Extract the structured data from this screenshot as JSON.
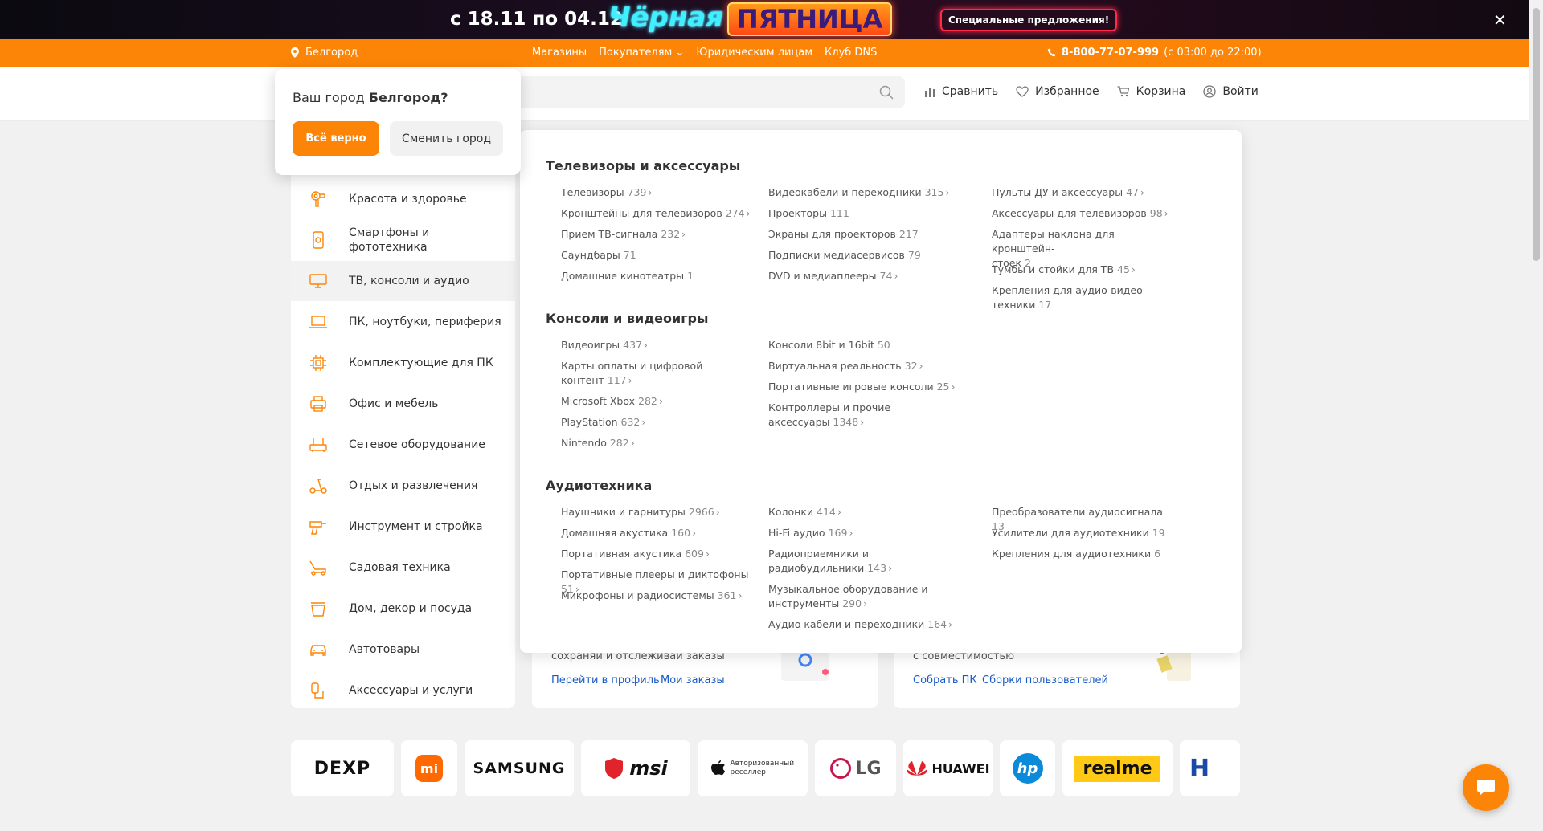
{
  "promo": {
    "dates": "с 18.11 по 04.12",
    "title_part1": "Чёрная",
    "title_part2": "ПЯТНИЦА",
    "special": "Специальные предложения!",
    "close_icon": "close-icon"
  },
  "topbar": {
    "city": "Белгород",
    "nav": [
      "Магазины",
      "Покупателям",
      "Юридическим лицам",
      "Клуб DNS"
    ],
    "phone": "8-800-77-07-999",
    "hours": "(с 03:00 до 22:00)"
  },
  "header": {
    "search_placeholder": "",
    "actions": [
      "Сравнить",
      "Избранное",
      "Корзина",
      "Войти"
    ]
  },
  "city_popup": {
    "question": "Ваш город ",
    "city": "Белгород?",
    "confirm": "Всё верно",
    "change": "Сменить город"
  },
  "sidebar": {
    "items": [
      {
        "label": "Красота и здоровье",
        "icon": "hairdryer-icon"
      },
      {
        "label": "Смартфоны и фототехника",
        "icon": "smartphone-icon"
      },
      {
        "label": "ТВ, консоли и аудио",
        "icon": "tv-icon"
      },
      {
        "label": "ПК, ноутбуки, периферия",
        "icon": "laptop-icon"
      },
      {
        "label": "Комплектующие для ПК",
        "icon": "chip-icon"
      },
      {
        "label": "Офис и мебель",
        "icon": "printer-icon"
      },
      {
        "label": "Сетевое оборудование",
        "icon": "router-icon"
      },
      {
        "label": "Отдых и развлечения",
        "icon": "scooter-icon"
      },
      {
        "label": "Инструмент и стройка",
        "icon": "drill-icon"
      },
      {
        "label": "Садовая техника",
        "icon": "lawnmower-icon"
      },
      {
        "label": "Дом, декор и посуда",
        "icon": "pot-icon"
      },
      {
        "label": "Автотовары",
        "icon": "car-icon"
      },
      {
        "label": "Аксессуары и услуги",
        "icon": "accessories-icon"
      }
    ]
  },
  "mega": {
    "sections": [
      {
        "title": "Телевизоры и аксессуары",
        "col1": [
          {
            "t": "Телевизоры",
            "n": "739",
            "c": true
          },
          {
            "t": "Кронштейны для телевизоров",
            "n": "274",
            "c": true
          },
          {
            "t": "Прием ТВ-сигнала",
            "n": "232",
            "c": true
          },
          {
            "t": "Саундбары",
            "n": "71",
            "c": false
          },
          {
            "t": "Домашние кинотеатры",
            "n": "1",
            "c": false
          }
        ],
        "col2": [
          {
            "t": "Видеокабели и переходники",
            "n": "315",
            "c": true
          },
          {
            "t": "Проекторы",
            "n": "111",
            "c": false
          },
          {
            "t": "Экраны для проекторов",
            "n": "217",
            "c": false
          },
          {
            "t": "Подписки медиасервисов",
            "n": "79",
            "c": false
          },
          {
            "t": "DVD и медиаплееры",
            "n": "74",
            "c": true
          }
        ],
        "col3": [
          {
            "t": "Пульты ДУ и аксессуары",
            "n": "47",
            "c": true
          },
          {
            "t": "Аксессуары для телевизоров",
            "n": "98",
            "c": true
          },
          {
            "t": "Адаптеры наклона для кронштейн-",
            "t2": "стоек",
            "n": "2",
            "c": false
          },
          {
            "t": "Тумбы и стойки для ТВ",
            "n": "45",
            "c": true
          },
          {
            "t": "Крепления для аудио-видео",
            "t2": "техники",
            "n": "17",
            "c": false
          }
        ]
      },
      {
        "title": "Консоли и видеоигры",
        "col1": [
          {
            "t": "Видеоигры",
            "n": "437",
            "c": true
          },
          {
            "t": "Карты оплаты и цифровой",
            "t2": "контент",
            "n": "117",
            "c": true
          },
          {
            "t": "Microsoft Xbox",
            "n": "282",
            "c": true
          },
          {
            "t": "PlayStation",
            "n": "632",
            "c": true
          },
          {
            "t": "Nintendo",
            "n": "282",
            "c": true
          }
        ],
        "col2": [
          {
            "t": "Консоли 8bit и 16bit",
            "n": "50",
            "c": false
          },
          {
            "t": "Виртуальная реальность",
            "n": "32",
            "c": true
          },
          {
            "t": "Портативные игровые консоли",
            "n": "25",
            "c": true
          },
          {
            "t": "Контроллеры и прочие",
            "t2": "аксессуары",
            "n": "1348",
            "c": true
          }
        ],
        "col3": []
      },
      {
        "title": "Аудиотехника",
        "col1": [
          {
            "t": "Наушники и гарнитуры",
            "n": "2966",
            "c": true
          },
          {
            "t": "Домашняя акустика",
            "n": "160",
            "c": true
          },
          {
            "t": "Портативная акустика",
            "n": "609",
            "c": true
          },
          {
            "t": "Портативные плееры и диктофоны",
            "n": "51",
            "c": true
          },
          {
            "t": "Микрофоны и радиосистемы",
            "n": "361",
            "c": true
          }
        ],
        "col2": [
          {
            "t": "Колонки",
            "n": "414",
            "c": true
          },
          {
            "t": "Hi-Fi аудио",
            "n": "169",
            "c": true
          },
          {
            "t": "Радиоприемники и",
            "t2": "радиобудильники",
            "n": "143",
            "c": true
          },
          {
            "t": "Музыкальное оборудование и",
            "t2": "инструменты",
            "n": "290",
            "c": true
          },
          {
            "t": "Аудио кабели и переходники",
            "n": "164",
            "c": true
          }
        ],
        "col3": [
          {
            "t": "Преобразователи аудиосигнала",
            "n": "13",
            "c": false
          },
          {
            "t": "Усилители для аудиотехники",
            "n": "19",
            "c": false
          },
          {
            "t": "Крепления для аудиотехники",
            "n": "6",
            "c": false
          }
        ]
      }
    ]
  },
  "cards": {
    "profile_text": "сохраняй и отслеживай заказы",
    "profile_link1": "Перейти в профиль",
    "profile_link2": "Мои заказы",
    "pc_text": "с совместимостью",
    "pc_link1": "Собрать ПК",
    "pc_link2": "Сборки пользователей"
  },
  "brands": [
    "DEXP",
    "mi",
    "SAMSUNG",
    "msi",
    "Авторизованный реселлер",
    "LG",
    "HUAWEI",
    "hp",
    "realme",
    "H"
  ],
  "colors": {
    "accent": "#fc8507",
    "link": "#1a5ac4"
  }
}
